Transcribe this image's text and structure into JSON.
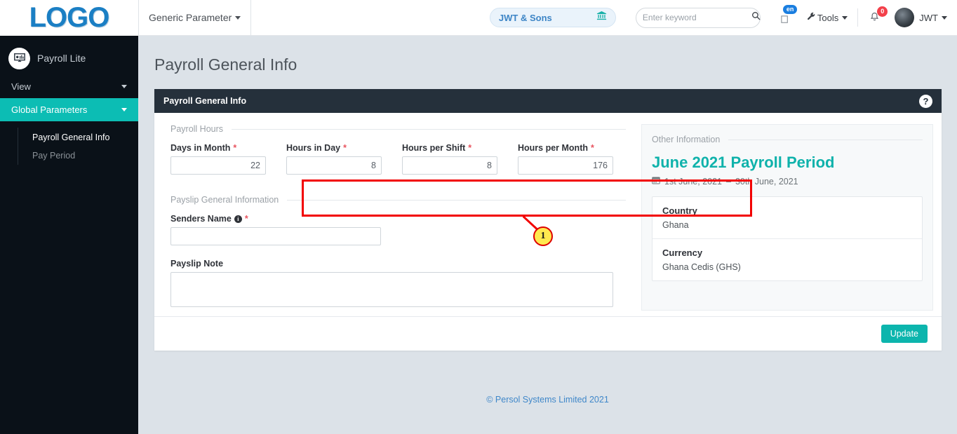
{
  "topbar": {
    "logo": "LOGO",
    "generic_parameter": "Generic Parameter",
    "company": "JWT & Sons",
    "company_icon": "bank-icon",
    "search_placeholder": "Enter keyword",
    "search_value": "",
    "search_icon": "search-icon",
    "language_badge": "en",
    "language_icon": "language-icon",
    "tools_label": "Tools",
    "tools_icon": "wrench-icon",
    "notification_count": "0",
    "notification_icon": "bell-icon",
    "user_name": "JWT",
    "avatar_icon": "user-avatar"
  },
  "sidebar": {
    "brand": "Payroll Lite",
    "brand_icon": "monitor-chart-icon",
    "items": [
      {
        "label": "View",
        "active": false,
        "icon": "chevron-down-icon"
      },
      {
        "label": "Global Parameters",
        "active": true,
        "icon": "chevron-down-icon"
      }
    ],
    "subitems": [
      {
        "label": "Payroll General Info",
        "active": true
      },
      {
        "label": "Pay Period",
        "active": false
      }
    ]
  },
  "main": {
    "page_title": "Payroll General Info",
    "panel_title": "Payroll General Info",
    "help_icon": "question-mark-icon",
    "sections": {
      "payroll_hours_legend": "Payroll Hours",
      "payslip_legend": "Payslip General Information",
      "other_info_legend": "Other Information"
    },
    "payroll_hours_fields": [
      {
        "label": "Days in Month",
        "required": "*",
        "value": "22"
      },
      {
        "label": "Hours in Day",
        "required": "*",
        "value": "8"
      },
      {
        "label": "Hours per Shift",
        "required": "*",
        "value": "8"
      },
      {
        "label": "Hours per Month",
        "required": "*",
        "value": "176"
      }
    ],
    "senders_name": {
      "label": "Senders Name",
      "required": "*",
      "value": "",
      "info_icon": "info-icon"
    },
    "payslip_note": {
      "label": "Payslip Note",
      "value": ""
    },
    "other_information": {
      "period_title": "June 2021  Payroll Period",
      "date_from": "1st June, 2021",
      "date_sep": "–",
      "date_to": "30th June, 2021",
      "calendar_icon": "calendar-icon",
      "rows": [
        {
          "key": "Country",
          "value": "Ghana"
        },
        {
          "key": "Currency",
          "value": "Ghana Cedis (GHS)"
        }
      ]
    },
    "update_label": "Update",
    "footer": "© Persol Systems Limited 2021"
  },
  "annotation": {
    "marker_label": "1",
    "box_color": "#f20000",
    "marker_fill": "#ffe94f"
  },
  "colors": {
    "accent_teal": "#0cb5ad",
    "panel_dark": "#25303b",
    "sidebar_dark": "#0a1118",
    "link_blue": "#3f87c9"
  }
}
